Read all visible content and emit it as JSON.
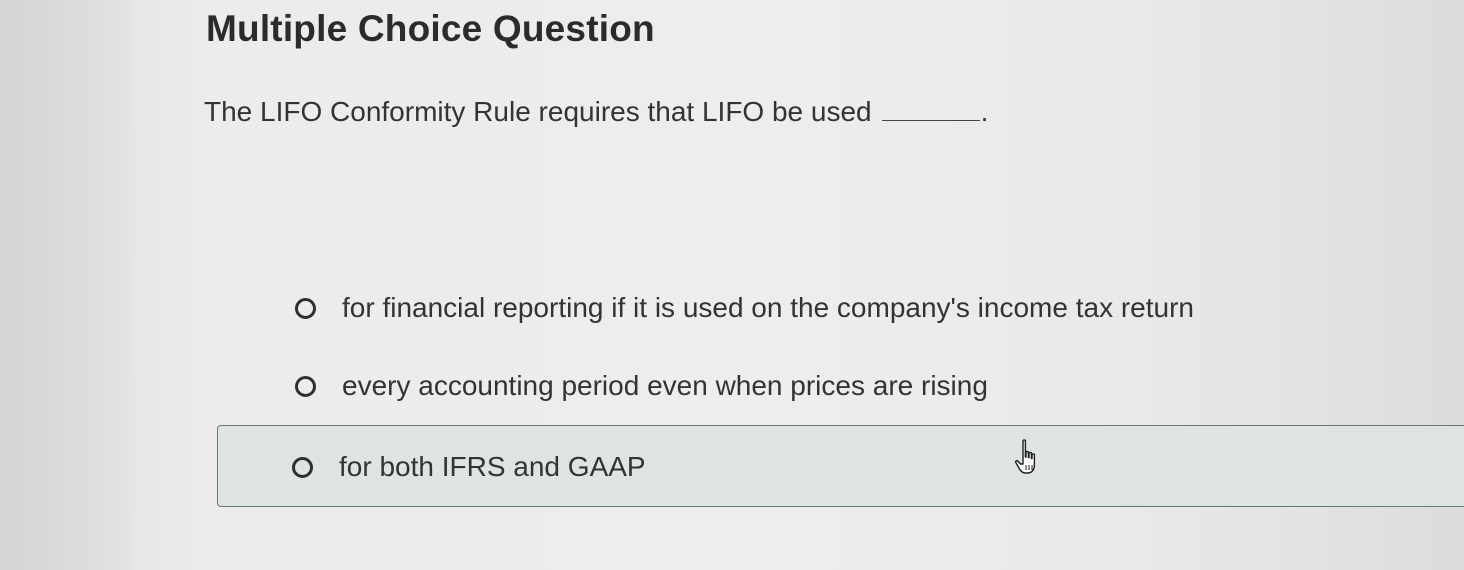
{
  "page": {
    "title": "Multiple Choice Question"
  },
  "question": {
    "text": "The LIFO Conformity Rule requires that LIFO be used",
    "end": "."
  },
  "options": [
    {
      "label": "for financial reporting if it is used on the company's income tax return",
      "selected": false
    },
    {
      "label": "every accounting period even when prices are rising",
      "selected": false
    },
    {
      "label": "for both IFRS and GAAP",
      "selected": false,
      "hovered": true
    }
  ],
  "cursor": {
    "icon": "hand-pointer-icon"
  },
  "colors": {
    "background": "#ececea",
    "hover_fill": "#dde4e3",
    "hover_border": "#6c7778",
    "text": "#333333"
  }
}
